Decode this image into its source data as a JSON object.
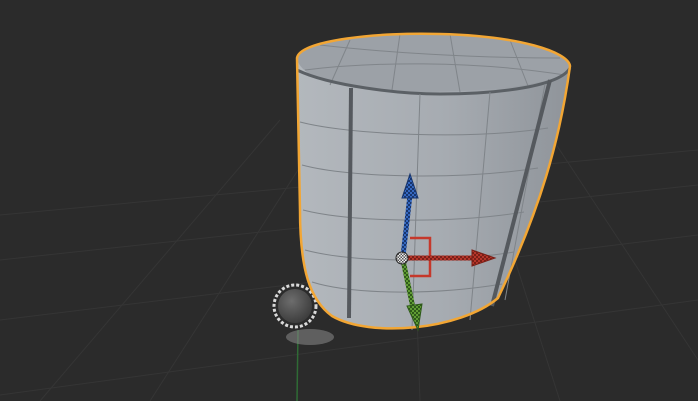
{
  "viewport": {
    "background_color": "#2b2b2b",
    "grid_color": "#353535",
    "y_axis_color": "#2f6b35"
  },
  "selected_object": {
    "type": "cylinder-mesh",
    "outline_color": "#f2a634",
    "surface_color": "#a9aeb4",
    "wireframe_color": "#7f8489"
  },
  "gizmo": {
    "type": "move-gizmo",
    "x_axis_color": "#c5382b",
    "y_axis_color": "#4f8e2f",
    "z_axis_color": "#2c5fb0",
    "pivot_color": "#e0e0e0"
  },
  "light": {
    "type": "point-light",
    "fill_color": "#555555",
    "ring_color": "#d9d9d9"
  }
}
